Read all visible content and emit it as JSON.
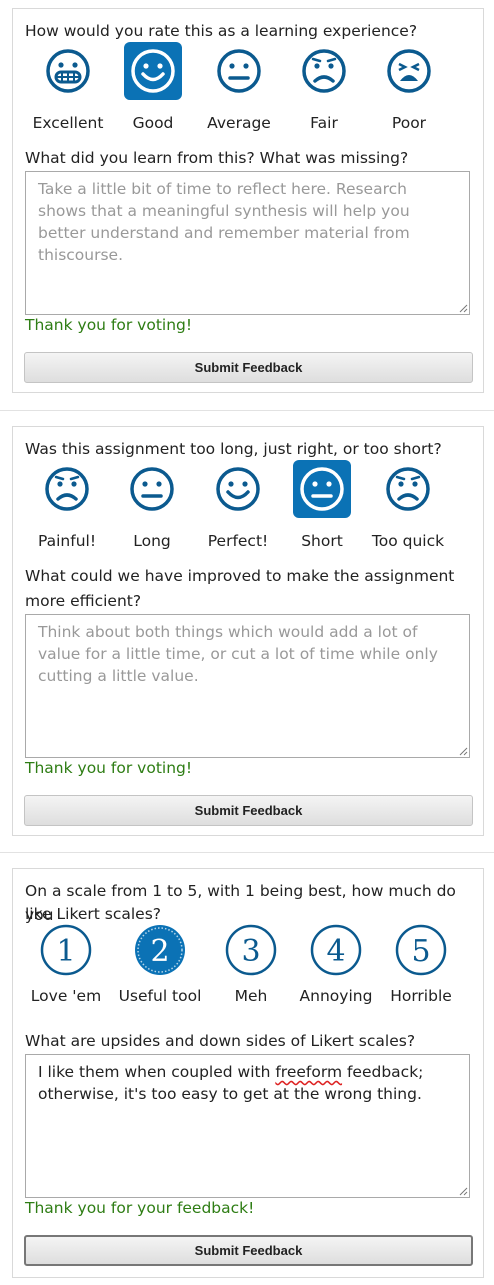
{
  "colors": {
    "accent": "#0b72b5",
    "icon_stroke": "#0b5a8f",
    "thanks": "#2e7d14"
  },
  "sections": [
    {
      "question": "How would you rate this as a learning experience?",
      "options": [
        {
          "label": "Excellent",
          "icon": "grin-icon"
        },
        {
          "label": "Good",
          "icon": "smile-icon",
          "selected": true
        },
        {
          "label": "Average",
          "icon": "neutral-face-icon"
        },
        {
          "label": "Fair",
          "icon": "frown-icon"
        },
        {
          "label": "Poor",
          "icon": "crying-face-icon"
        }
      ],
      "prompt": "What did you learn from this? What was missing?",
      "placeholder": "Take a little bit of time to reflect here. Research shows that a meaningful synthesis will help you better understand and remember material from thiscourse.",
      "value": "",
      "thanks": "Thank you for voting!",
      "submit": "Submit Feedback"
    },
    {
      "question": "Was this assignment too long, just right, or too short?",
      "options": [
        {
          "label": "Painful!",
          "icon": "frown-icon"
        },
        {
          "label": "Long",
          "icon": "neutral-face-icon"
        },
        {
          "label": "Perfect!",
          "icon": "smile-icon"
        },
        {
          "label": "Short",
          "icon": "neutral-face-icon",
          "selected": true
        },
        {
          "label": "Too quick",
          "icon": "frown-icon"
        }
      ],
      "prompt_line1": "What could we have improved to make the assignment",
      "prompt_line2": "more efficient?",
      "placeholder": "Think about both things which would add a lot of value for a little time, or cut a lot of time while only cutting a little value.",
      "value": "",
      "thanks": "Thank you for voting!",
      "submit": "Submit Feedback"
    },
    {
      "question_line1": "On a scale from 1 to 5, with 1 being best, how much do you",
      "question_line2": "like Likert scales?",
      "options": [
        {
          "label": "Love 'em",
          "number": "1"
        },
        {
          "label": "Useful tool",
          "number": "2",
          "selected": true
        },
        {
          "label": "Meh",
          "number": "3"
        },
        {
          "label": "Annoying",
          "number": "4"
        },
        {
          "label": "Horrible",
          "number": "5"
        }
      ],
      "prompt": "What are upsides and down sides of Likert scales?",
      "value_before": "I like them when coupled with ",
      "value_misspelled": "freeform",
      "value_after": " feedback; otherwise, it's too easy to get at the wrong thing.",
      "thanks": "Thank you for your feedback!",
      "submit": "Submit Feedback"
    }
  ]
}
